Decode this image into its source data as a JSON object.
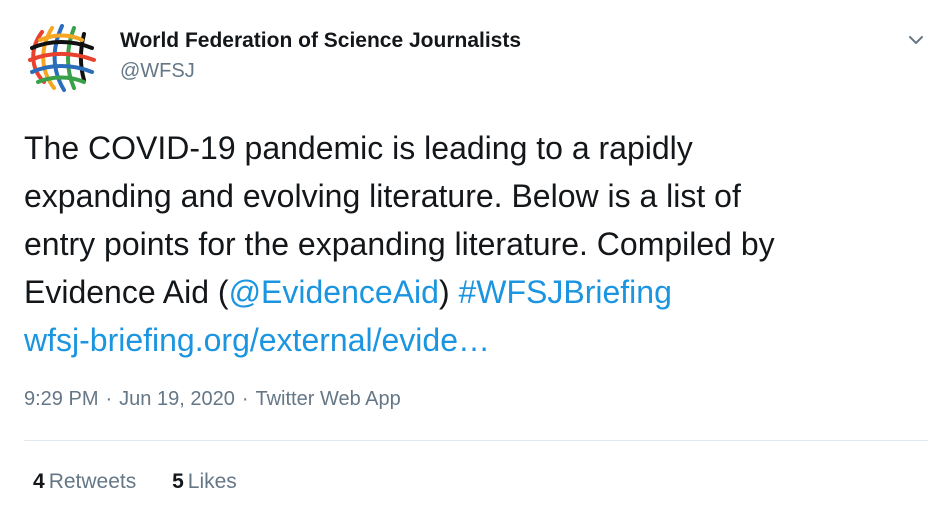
{
  "author": {
    "name": "World Federation of Science Journalists",
    "handle": "@WFSJ"
  },
  "tweet": {
    "line1": "The COVID-19 pandemic is leading to a rapidly",
    "line2": "expanding and evolving literature. Below is a list of",
    "line3": "entry points for the expanding literature. Compiled by",
    "line4_prefix": "Evidence Aid (",
    "mention": "@EvidenceAid",
    "line4_mid": ") ",
    "hashtag": "#WFSJBriefing",
    "url": "wfsj-briefing.org/external/evide…"
  },
  "meta": {
    "time": "9:29 PM",
    "separator": "·",
    "date": "Jun 19, 2020",
    "source": "Twitter Web App"
  },
  "stats": {
    "retweets_count": "4",
    "retweets_label": "Retweets",
    "likes_count": "5",
    "likes_label": "Likes"
  },
  "colors": {
    "link": "#1b95e0",
    "text": "#14171a",
    "secondary": "#657786",
    "divider": "#e1e8ed"
  },
  "icons": {
    "avatar": "wfsj-globe-logo",
    "menu": "chevron-down-icon"
  }
}
